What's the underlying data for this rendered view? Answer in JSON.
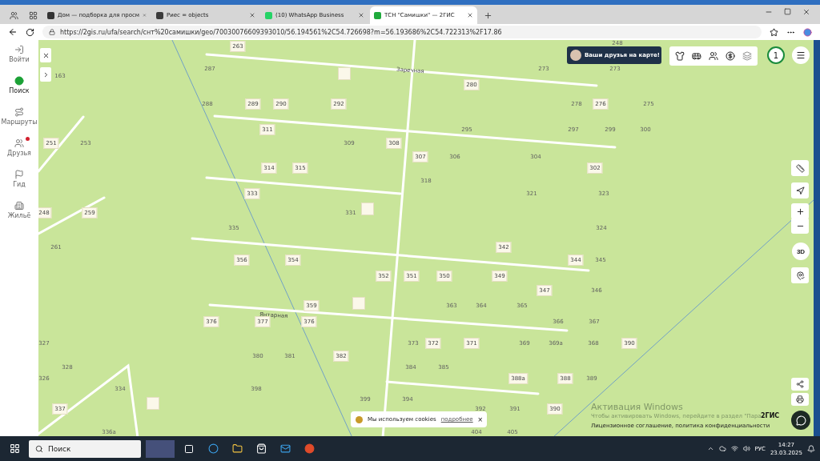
{
  "browser": {
    "tabs": [
      {
        "title": "Дом — подборка для просм",
        "selected": false
      },
      {
        "title": "Риес = objects",
        "selected": false
      },
      {
        "title": "(10) WhatsApp Business",
        "selected": false
      },
      {
        "title": "ТСН \"Самишки\" — 2ГИС",
        "selected": true
      }
    ],
    "url": "https://2gis.ru/ufa/search/снт%20самишки/geo/70030076609393010/56.194561%2C54.726698?m=56.193686%2C54.722313%2F17.86"
  },
  "sidebar": {
    "items": [
      {
        "label": "Войти",
        "selected": false,
        "badge": false
      },
      {
        "label": "Поиск",
        "selected": true,
        "badge": false
      },
      {
        "label": "Маршруты",
        "selected": false,
        "badge": false
      },
      {
        "label": "Друзья",
        "selected": false,
        "badge": true
      },
      {
        "label": "Гид",
        "selected": false,
        "badge": false
      },
      {
        "label": "Жильё",
        "selected": false,
        "badge": false
      }
    ]
  },
  "map": {
    "streets": [
      "Заречная",
      "Янтарная"
    ],
    "houses": [
      {
        "number": "263",
        "kind": "tile"
      },
      {
        "number": "248",
        "kind": "plain"
      },
      {
        "number": "287",
        "kind": "plain"
      },
      {
        "number": "273",
        "kind": "plain"
      },
      {
        "number": "273",
        "kind": "plain"
      },
      {
        "number": "163",
        "kind": "plain"
      },
      {
        "number": "280",
        "kind": "tile"
      },
      {
        "number": "288",
        "kind": "plain"
      },
      {
        "number": "289",
        "kind": "tile"
      },
      {
        "number": "290",
        "kind": "tile"
      },
      {
        "number": "292",
        "kind": "tile"
      },
      {
        "number": "278",
        "kind": "plain"
      },
      {
        "number": "276",
        "kind": "tile"
      },
      {
        "number": "275",
        "kind": "plain"
      },
      {
        "number": "311",
        "kind": "tile"
      },
      {
        "number": "295",
        "kind": "plain"
      },
      {
        "number": "297",
        "kind": "plain"
      },
      {
        "number": "299",
        "kind": "plain"
      },
      {
        "number": "300",
        "kind": "plain"
      },
      {
        "number": "251",
        "kind": "tile"
      },
      {
        "number": "253",
        "kind": "plain"
      },
      {
        "number": "309",
        "kind": "plain"
      },
      {
        "number": "308",
        "kind": "tile"
      },
      {
        "number": "307",
        "kind": "tile"
      },
      {
        "number": "306",
        "kind": "plain"
      },
      {
        "number": "304",
        "kind": "plain"
      },
      {
        "number": "314",
        "kind": "tile"
      },
      {
        "number": "315",
        "kind": "tile"
      },
      {
        "number": "302",
        "kind": "tile"
      },
      {
        "number": "318",
        "kind": "plain"
      },
      {
        "number": "333",
        "kind": "tile"
      },
      {
        "number": "321",
        "kind": "plain"
      },
      {
        "number": "323",
        "kind": "plain"
      },
      {
        "number": "248",
        "kind": "tile"
      },
      {
        "number": "259",
        "kind": "tile"
      },
      {
        "number": "331",
        "kind": "plain"
      },
      {
        "number": "335",
        "kind": "plain"
      },
      {
        "number": "324",
        "kind": "plain"
      },
      {
        "number": "261",
        "kind": "plain"
      },
      {
        "number": "342",
        "kind": "tile"
      },
      {
        "number": "356",
        "kind": "tile"
      },
      {
        "number": "354",
        "kind": "tile"
      },
      {
        "number": "344",
        "kind": "tile"
      },
      {
        "number": "345",
        "kind": "plain"
      },
      {
        "number": "352",
        "kind": "tile"
      },
      {
        "number": "351",
        "kind": "tile"
      },
      {
        "number": "350",
        "kind": "tile"
      },
      {
        "number": "349",
        "kind": "tile"
      },
      {
        "number": "347",
        "kind": "tile"
      },
      {
        "number": "346",
        "kind": "plain"
      },
      {
        "number": "359",
        "kind": "tile"
      },
      {
        "number": "363",
        "kind": "plain"
      },
      {
        "number": "364",
        "kind": "plain"
      },
      {
        "number": "365",
        "kind": "plain"
      },
      {
        "number": "376",
        "kind": "tile"
      },
      {
        "number": "377",
        "kind": "tile"
      },
      {
        "number": "376",
        "kind": "tile"
      },
      {
        "number": "366",
        "kind": "plain"
      },
      {
        "number": "367",
        "kind": "plain"
      },
      {
        "number": "327",
        "kind": "plain"
      },
      {
        "number": "373",
        "kind": "plain"
      },
      {
        "number": "372",
        "kind": "tile"
      },
      {
        "number": "371",
        "kind": "tile"
      },
      {
        "number": "369",
        "kind": "plain"
      },
      {
        "number": "369а",
        "kind": "plain"
      },
      {
        "number": "368",
        "kind": "plain"
      },
      {
        "number": "390",
        "kind": "tile"
      },
      {
        "number": "380",
        "kind": "plain"
      },
      {
        "number": "381",
        "kind": "plain"
      },
      {
        "number": "382",
        "kind": "tile"
      },
      {
        "number": "328",
        "kind": "plain"
      },
      {
        "number": "384",
        "kind": "plain"
      },
      {
        "number": "385",
        "kind": "plain"
      },
      {
        "number": "326",
        "kind": "plain"
      },
      {
        "number": "388а",
        "kind": "tile"
      },
      {
        "number": "388",
        "kind": "tile"
      },
      {
        "number": "389",
        "kind": "plain"
      },
      {
        "number": "334",
        "kind": "plain"
      },
      {
        "number": "398",
        "kind": "plain"
      },
      {
        "number": "399",
        "kind": "plain"
      },
      {
        "number": "394",
        "kind": "plain"
      },
      {
        "number": "337",
        "kind": "tile"
      },
      {
        "number": "392",
        "kind": "plain"
      },
      {
        "number": "391",
        "kind": "plain"
      },
      {
        "number": "390",
        "kind": "tile"
      },
      {
        "number": "336а",
        "kind": "plain"
      },
      {
        "number": "404",
        "kind": "plain"
      },
      {
        "number": "405",
        "kind": "plain"
      }
    ],
    "friends_banner": "Ваши друзья на карте!",
    "counter": "1",
    "view_3d": "3D",
    "cookie": {
      "text": "Мы используем cookies",
      "link": "подробнее",
      "close": "×"
    },
    "activation": {
      "title": "Активация Windows",
      "text": "Чтобы активировать Windows, перейдите в раздел \"Пара"
    },
    "brand": "2ГИС",
    "legal": "Лицензионное соглашение, политика конфиденциальности"
  },
  "taskbar": {
    "search_placeholder": "Поиск",
    "language": "РУС",
    "time": "14:27",
    "date": "23.03.2025"
  }
}
